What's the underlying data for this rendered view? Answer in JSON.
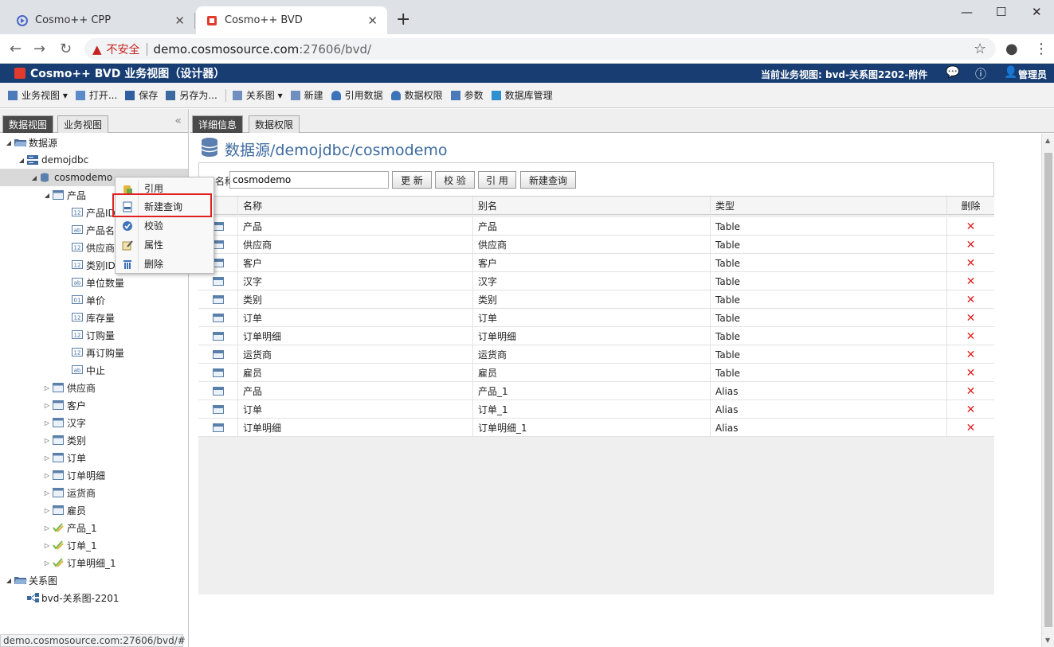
{
  "browser": {
    "tabs": [
      {
        "title": "Cosmo++ CPP",
        "active": false
      },
      {
        "title": "Cosmo++ BVD",
        "active": true
      }
    ],
    "new_tab": "+",
    "insecure_label": "不安全",
    "url_host": "demo.cosmosource.com",
    "url_path": ":27606/bvd/",
    "status_url": "demo.cosmosource.com:27606/bvd/#"
  },
  "app": {
    "title": "Cosmo++ BVD 业务视图（设计器）",
    "current_view": "当前业务视图: bvd-关系图2202-附件",
    "user": "管理员"
  },
  "toolbar": {
    "items": [
      {
        "label": "业务视图 ▾",
        "icon": "business-view-icon"
      },
      {
        "label": "打开...",
        "icon": "open-icon"
      },
      {
        "label": "保存",
        "icon": "save-icon"
      },
      {
        "label": "另存为...",
        "icon": "save-as-icon"
      },
      {
        "label": "关系图 ▾",
        "icon": "diagram-icon"
      },
      {
        "label": "新建",
        "icon": "new-icon"
      },
      {
        "label": "引用数据",
        "icon": "reference-data-icon"
      },
      {
        "label": "数据权限",
        "icon": "data-permission-icon"
      },
      {
        "label": "参数",
        "icon": "parameter-icon"
      },
      {
        "label": "数据库管理",
        "icon": "database-manage-icon"
      }
    ]
  },
  "left": {
    "tabs": [
      "数据视图",
      "业务视图"
    ],
    "tree": [
      {
        "label": "数据源",
        "level": 0,
        "twisty": "▲",
        "icon": "folder"
      },
      {
        "label": "demojdbc",
        "level": 1,
        "twisty": "▲",
        "icon": "server"
      },
      {
        "label": "cosmodemo",
        "level": 2,
        "twisty": "▲",
        "icon": "db",
        "selected": true
      },
      {
        "label": "产品",
        "level": 3,
        "twisty": "▲",
        "icon": "table"
      },
      {
        "label": "产品ID",
        "level": 4,
        "twisty": "",
        "icon": "num"
      },
      {
        "label": "产品名称",
        "level": 4,
        "twisty": "",
        "icon": "str"
      },
      {
        "label": "供应商ID",
        "level": 4,
        "twisty": "",
        "icon": "num"
      },
      {
        "label": "类别ID",
        "level": 4,
        "twisty": "",
        "icon": "num"
      },
      {
        "label": "单位数量",
        "level": 4,
        "twisty": "",
        "icon": "str"
      },
      {
        "label": "单价",
        "level": 4,
        "twisty": "",
        "icon": "dec"
      },
      {
        "label": "库存量",
        "level": 4,
        "twisty": "",
        "icon": "num"
      },
      {
        "label": "订购量",
        "level": 4,
        "twisty": "",
        "icon": "num"
      },
      {
        "label": "再订购量",
        "level": 4,
        "twisty": "",
        "icon": "num"
      },
      {
        "label": "中止",
        "level": 4,
        "twisty": "",
        "icon": "str"
      },
      {
        "label": "供应商",
        "level": 3,
        "twisty": "▷",
        "icon": "table"
      },
      {
        "label": "客户",
        "level": 3,
        "twisty": "▷",
        "icon": "table"
      },
      {
        "label": "汉字",
        "level": 3,
        "twisty": "▷",
        "icon": "table"
      },
      {
        "label": "类别",
        "level": 3,
        "twisty": "▷",
        "icon": "table"
      },
      {
        "label": "订单",
        "level": 3,
        "twisty": "▷",
        "icon": "table"
      },
      {
        "label": "订单明细",
        "level": 3,
        "twisty": "▷",
        "icon": "table"
      },
      {
        "label": "运货商",
        "level": 3,
        "twisty": "▷",
        "icon": "table"
      },
      {
        "label": "雇员",
        "level": 3,
        "twisty": "▷",
        "icon": "table"
      },
      {
        "label": "产品_1",
        "level": 3,
        "twisty": "▷",
        "icon": "alias"
      },
      {
        "label": "订单_1",
        "level": 3,
        "twisty": "▷",
        "icon": "alias"
      },
      {
        "label": "订单明细_1",
        "level": 3,
        "twisty": "▷",
        "icon": "alias"
      },
      {
        "label": "关系图",
        "level": 0,
        "twisty": "▲",
        "icon": "folder"
      },
      {
        "label": "bvd-关系图-2201",
        "level": 1,
        "twisty": "",
        "icon": "diagram"
      }
    ]
  },
  "context_menu": {
    "items": [
      {
        "label": "引用",
        "icon": "reference-icon"
      },
      {
        "label": "新建查询",
        "icon": "new-query-icon"
      },
      {
        "label": "校验",
        "icon": "validate-icon"
      },
      {
        "label": "属性",
        "icon": "properties-icon"
      },
      {
        "label": "删除",
        "icon": "delete-icon"
      }
    ]
  },
  "right": {
    "tabs": [
      "详细信息",
      "数据权限"
    ],
    "path_title": "数据源/demojdbc/cosmodemo",
    "form": {
      "name_label": "名称",
      "name_value": "cosmodemo",
      "buttons": [
        "更 新",
        "校 验",
        "引 用",
        "新建查询"
      ]
    },
    "table": {
      "columns": [
        "名称",
        "别名",
        "类型",
        "删除"
      ],
      "rows": [
        {
          "name": "产品",
          "alias": "产品",
          "type": "Table"
        },
        {
          "name": "供应商",
          "alias": "供应商",
          "type": "Table"
        },
        {
          "name": "客户",
          "alias": "客户",
          "type": "Table"
        },
        {
          "name": "汉字",
          "alias": "汉字",
          "type": "Table"
        },
        {
          "name": "类别",
          "alias": "类别",
          "type": "Table"
        },
        {
          "name": "订单",
          "alias": "订单",
          "type": "Table"
        },
        {
          "name": "订单明细",
          "alias": "订单明细",
          "type": "Table"
        },
        {
          "name": "运货商",
          "alias": "运货商",
          "type": "Table"
        },
        {
          "name": "雇员",
          "alias": "雇员",
          "type": "Table"
        },
        {
          "name": "产品",
          "alias": "产品_1",
          "type": "Alias"
        },
        {
          "name": "订单",
          "alias": "订单_1",
          "type": "Alias"
        },
        {
          "name": "订单明细",
          "alias": "订单明细_1",
          "type": "Alias"
        }
      ],
      "delete_glyph": "✕"
    }
  },
  "colors": {
    "header_bg": "#173d72",
    "accent_blue": "#3c6aa0",
    "delete_red": "#e02020",
    "highlight_red": "#e02020"
  }
}
